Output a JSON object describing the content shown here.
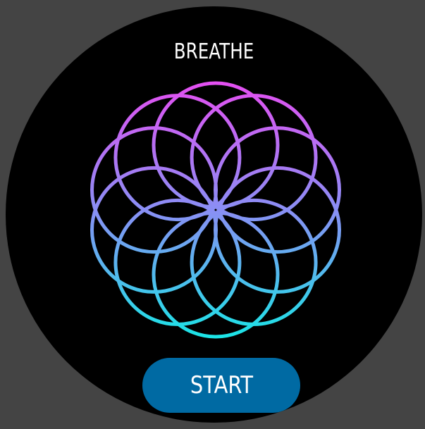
{
  "app": {
    "title": "BREATHE"
  },
  "animation": {
    "icon": "breathing-flower-icon",
    "petal_count": 10,
    "gradient_top": "#e64ef2",
    "gradient_mid": "#8a8ff5",
    "gradient_bottom": "#19e6e6"
  },
  "controls": {
    "start_label": "START",
    "start_color": "#006aa3"
  },
  "colors": {
    "background": "#444444",
    "face": "#000000"
  }
}
